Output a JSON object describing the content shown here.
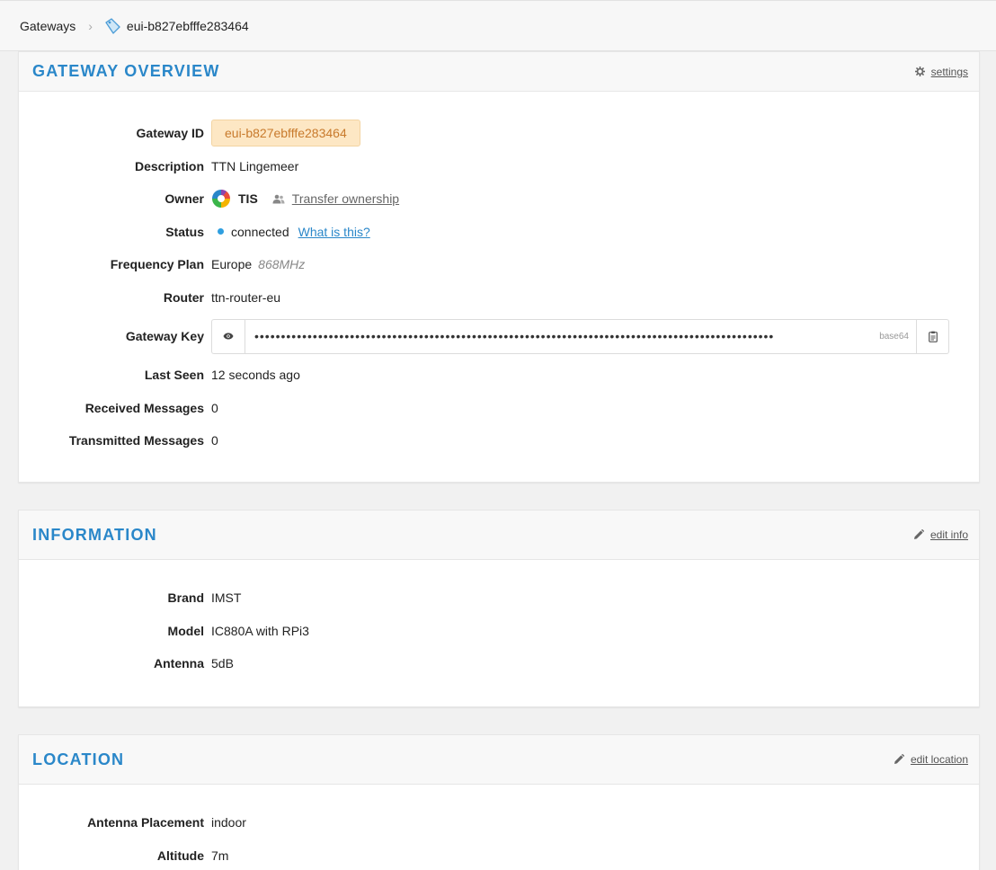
{
  "breadcrumb": {
    "root": "Gateways",
    "current": "eui-b827ebfffe283464"
  },
  "overview": {
    "title": "Gateway Overview",
    "action": "settings",
    "fields": {
      "gateway_id_label": "Gateway ID",
      "gateway_id": "eui-b827ebfffe283464",
      "description_label": "Description",
      "description": "TTN Lingemeer",
      "owner_label": "Owner",
      "owner": "TIS",
      "transfer_label": "Transfer ownership",
      "status_label": "Status",
      "status": "connected",
      "status_help": "What is this?",
      "frequency_label": "Frequency Plan",
      "frequency_region": "Europe",
      "frequency_mhz": "868MHz",
      "router_label": "Router",
      "router": "ttn-router-eu",
      "key_label": "Gateway Key",
      "key_masked": "••••••••••••••••••••••••••••••••••••••••••••••••••••••••••••••••••••••••••••••••••••••••••••••••••",
      "key_encoding": "base64",
      "last_seen_label": "Last Seen",
      "last_seen": "12 seconds ago",
      "received_label": "Received Messages",
      "received": "0",
      "transmitted_label": "Transmitted Messages",
      "transmitted": "0"
    }
  },
  "information": {
    "title": "Information",
    "action": "edit info",
    "brand_label": "Brand",
    "brand": "IMST",
    "model_label": "Model",
    "model": "IC880A with RPi3",
    "antenna_label": "Antenna",
    "antenna": "5dB"
  },
  "location": {
    "title": "Location",
    "action": "edit location",
    "placement_label": "Antenna Placement",
    "placement": "indoor",
    "altitude_label": "Altitude",
    "altitude": "7m"
  },
  "colors": {
    "accent": "#2a87c9",
    "badge_bg": "#fde7c4",
    "badge_text": "#c87a2c",
    "status_dot": "#2f9fe0"
  },
  "icons": {
    "breadcrumb_sep": "chevron-right-icon",
    "gateway": "gateway-tag-icon",
    "settings": "gear-icon",
    "edit": "pencil-icon",
    "transfer": "users-icon",
    "reveal": "eye-icon",
    "copy": "clipboard-icon"
  }
}
